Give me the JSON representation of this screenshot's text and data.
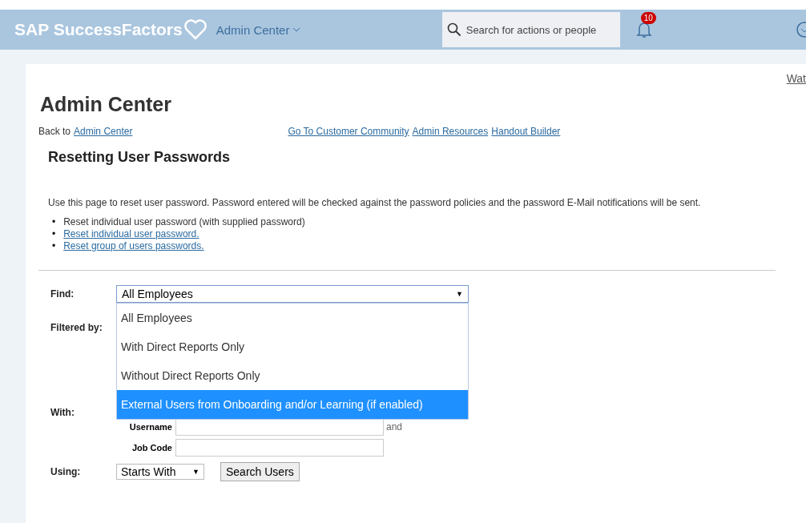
{
  "header": {
    "logo": "SAP SuccessFactors",
    "module": "Admin Center",
    "search": {
      "placeholder": "Search for actions or people"
    },
    "notifications": "10"
  },
  "watch_link": "Wat",
  "page_title": "Admin Center",
  "back": {
    "text": "Back to",
    "link": "Admin Center"
  },
  "top_links": [
    "Go To Customer Community",
    "Admin Resources",
    "Handout Builder"
  ],
  "section_title": "Resetting User Passwords",
  "intro": "Use this page to reset user password. Password entered will be checked against the password policies and the password E-Mail notifications will be sent.",
  "bullet": "•",
  "caret": "▼",
  "options": [
    {
      "text": "Reset individual user password (with supplied password)",
      "link": false
    },
    {
      "text": "Reset individual user password.",
      "link": true
    },
    {
      "text": "Reset group of users passwords.",
      "link": true
    }
  ],
  "form": {
    "find_label": "Find:",
    "find_value": "All Employees",
    "expanded": true,
    "find_options": [
      {
        "label": "All Employees",
        "selected": false
      },
      {
        "label": "With Direct Reports Only",
        "selected": false
      },
      {
        "label": "Without Direct Reports Only",
        "selected": false
      },
      {
        "label": "External Users from Onboarding and/or Learning (if enabled)",
        "selected": true
      }
    ],
    "filtered_label": "Filtered by:",
    "with_label": "With:",
    "fields": [
      {
        "label": "Username",
        "suffix": "and"
      },
      {
        "label": "Job Code"
      }
    ],
    "using_label": "Using:",
    "using_value": "Starts With",
    "search_button": "Search Users"
  }
}
